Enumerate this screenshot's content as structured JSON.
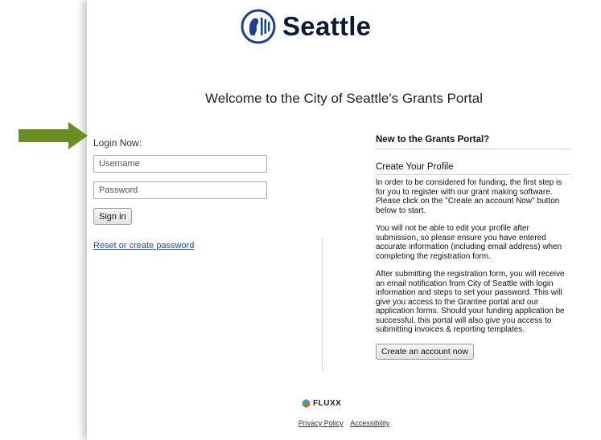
{
  "header": {
    "logo_text": "Seattle"
  },
  "welcome": "Welcome to the City of Seattle's Grants Portal",
  "login": {
    "heading": "Login Now:",
    "username_placeholder": "Username",
    "password_placeholder": "Password",
    "signin_label": "Sign in",
    "reset_link": "Reset or create password"
  },
  "register": {
    "heading": "New to the Grants Portal?",
    "subheading": "Create Your Profile",
    "paragraphs": [
      "In order to be considered for funding, the first step is for you to register with our grant making software. Please click on the \"Create an account Now\" button below to start.",
      "You will not be able to edit your profile after submission, so please ensure you have entered accurate information (including email address) when completing the registration form.",
      "After submitting the registration form, you will receive an email notification from City of Seattle with login information and steps to set your password.  This will give you access to the Grantee portal and our application forms. Should your funding application be successful, this portal will also give you access to submitting invoices & reporting templates."
    ],
    "button_label": "Create an account now"
  },
  "footer": {
    "brand": "FLUXX",
    "links": [
      "Privacy Policy",
      "Accessibility"
    ]
  },
  "colors": {
    "arrow": "#6b8e23",
    "link": "#1a4ab0",
    "logo_blue": "#1d3f8f"
  },
  "icons": {
    "logo": "seattle-seal-icon",
    "pointer": "right-arrow-icon",
    "brand": "fluxx-icon"
  }
}
